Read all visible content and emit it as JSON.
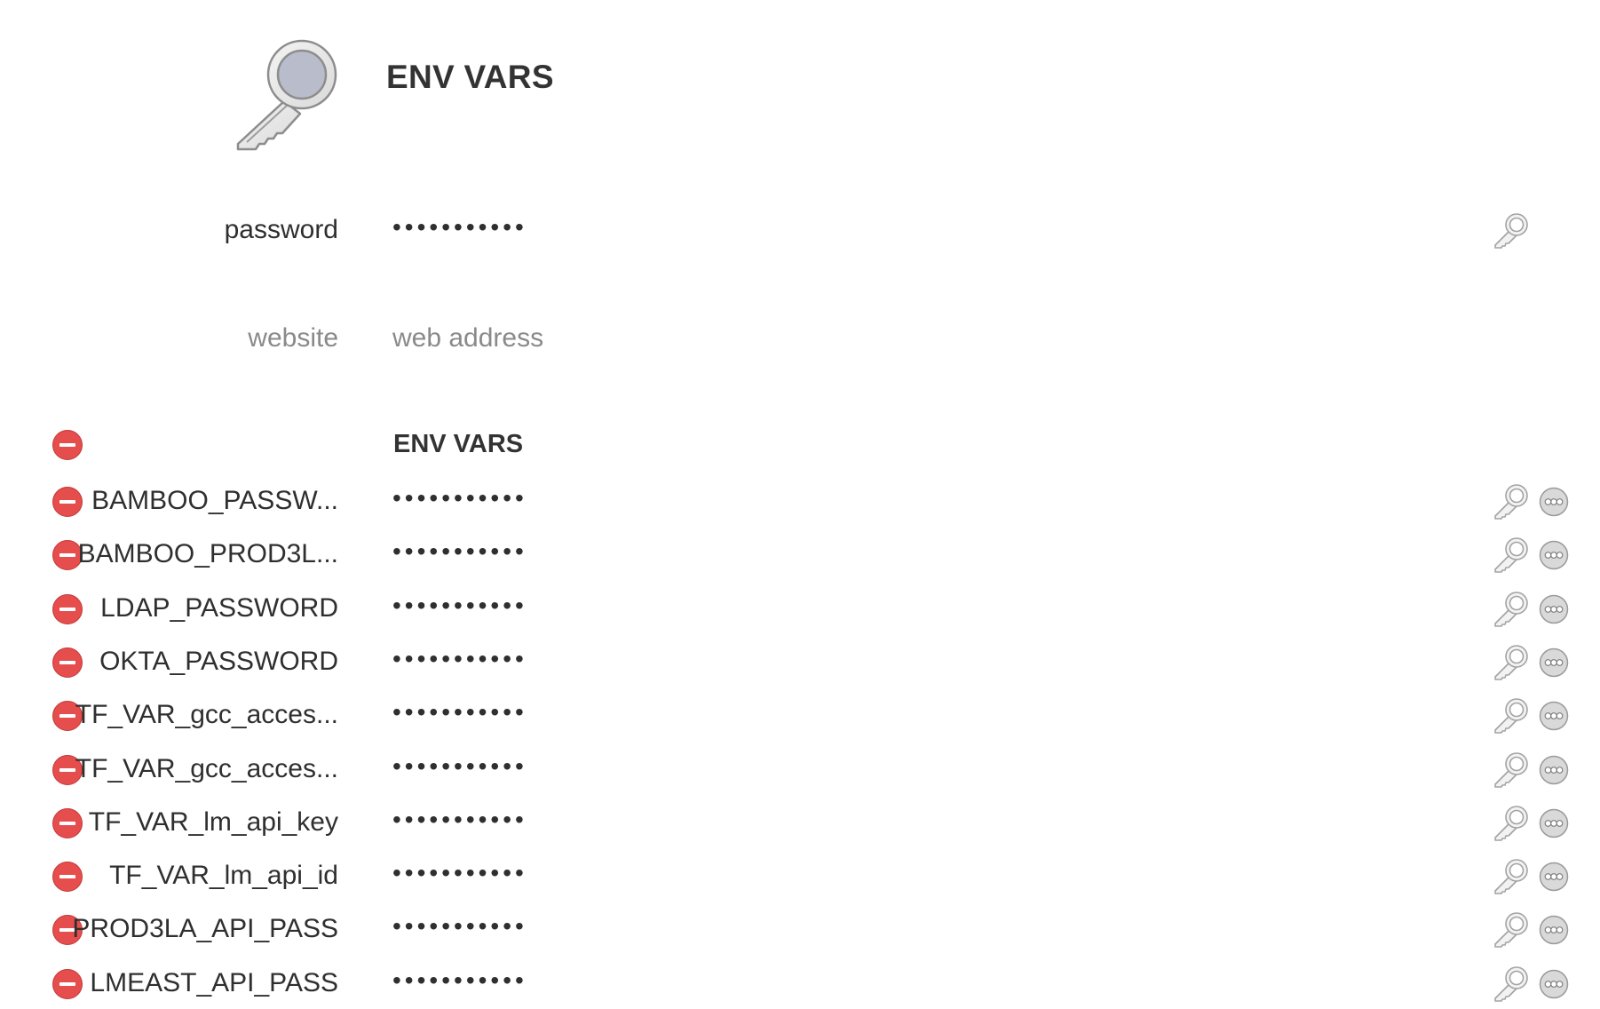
{
  "item": {
    "title": "ENV VARS",
    "icon": "key-icon"
  },
  "fields": {
    "password": {
      "label": "password",
      "value": "•••••••••••"
    },
    "website": {
      "label": "website",
      "placeholder": "web address"
    }
  },
  "section": {
    "title": "ENV VARS",
    "remove_icon": "remove-circle-icon"
  },
  "env_vars": [
    {
      "label": "BAMBOO_PASSW...",
      "value": "•••••••••••"
    },
    {
      "label": "BAMBOO_PROD3L...",
      "value": "•••••••••••"
    },
    {
      "label": "LDAP_PASSWORD",
      "value": "•••••••••••"
    },
    {
      "label": "OKTA_PASSWORD",
      "value": "•••••••••••"
    },
    {
      "label": "TF_VAR_gcc_acces...",
      "value": "•••••••••••"
    },
    {
      "label": "TF_VAR_gcc_acces...",
      "value": "•••••••••••"
    },
    {
      "label": "TF_VAR_lm_api_key",
      "value": "•••••••••••"
    },
    {
      "label": "TF_VAR_lm_api_id",
      "value": "•••••••••••"
    },
    {
      "label": "PROD3LA_API_PASS",
      "value": "•••••••••••"
    },
    {
      "label": "LMEAST_API_PASS",
      "value": "•••••••••••"
    }
  ],
  "icons": {
    "generate": "password-generator-key-icon",
    "more": "more-options-icon"
  },
  "colors": {
    "remove_red": "#e64d4d",
    "muted_text": "#8a8a8a",
    "icon_gray": "#a9a9a9"
  }
}
